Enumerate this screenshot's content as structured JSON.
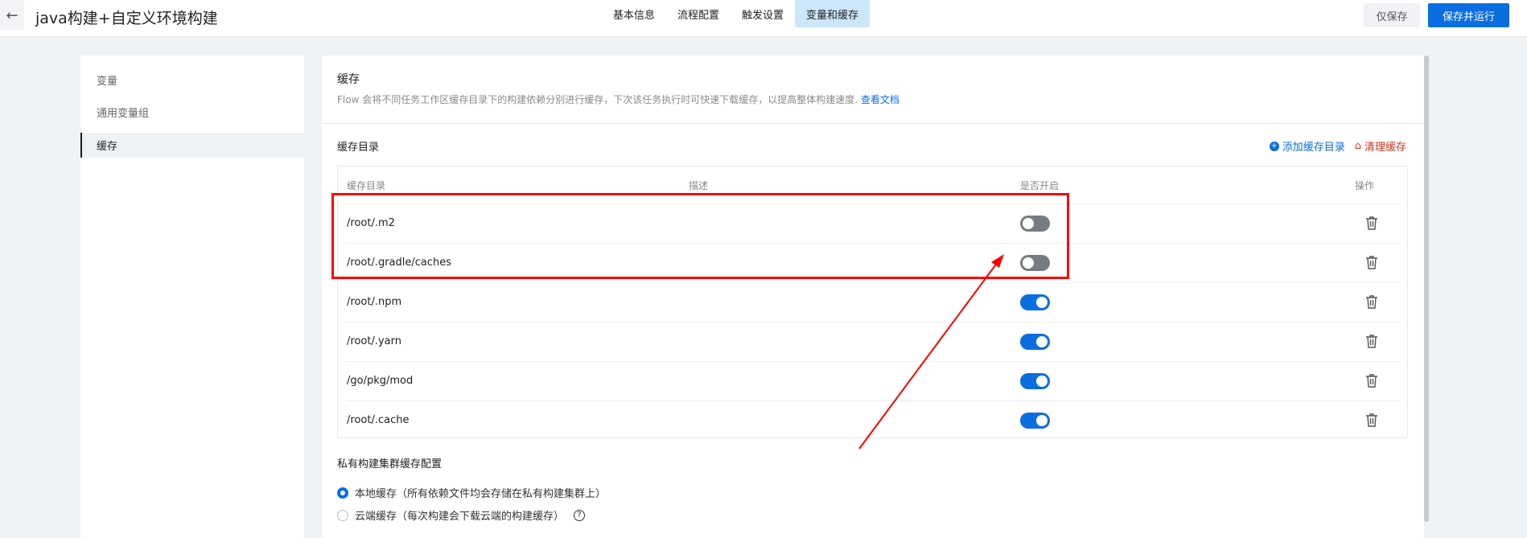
{
  "header": {
    "title": "java构建+自定义环境构建",
    "tabs": [
      {
        "label": "基本信息"
      },
      {
        "label": "流程配置"
      },
      {
        "label": "触发设置"
      },
      {
        "label": "变量和缓存"
      }
    ],
    "save_label": "仅保存",
    "save_run_label": "保存并运行"
  },
  "sidebar": {
    "items": [
      {
        "label": "变量"
      },
      {
        "label": "通用变量组"
      },
      {
        "label": "缓存"
      }
    ]
  },
  "main": {
    "title": "缓存",
    "description": "Flow 会将不同任务工作区缓存目录下的构建依赖分别进行缓存，下次该任务执行时可快速下载缓存，以提高整体构建速度.",
    "doc_link": "查看文档",
    "cache_dir_title": "缓存目录",
    "add_label": "添加缓存目录",
    "clear_label": "清理缓存",
    "columns": [
      "缓存目录",
      "描述",
      "是否开启",
      "操作"
    ],
    "rows": [
      {
        "path": "/root/.m2",
        "enabled": false
      },
      {
        "path": "/root/.gradle/caches",
        "enabled": false
      },
      {
        "path": "/root/.npm",
        "enabled": true
      },
      {
        "path": "/root/.yarn",
        "enabled": true
      },
      {
        "path": "/go/pkg/mod",
        "enabled": true
      },
      {
        "path": "/root/.cache",
        "enabled": true
      }
    ],
    "private_title": "私有构建集群缓存配置",
    "radio_options": [
      {
        "label": "本地缓存（所有依赖文件均会存储在私有构建集群上）",
        "selected": true
      },
      {
        "label": "云端缓存（每次构建会下载云端的构建缓存）",
        "selected": false
      }
    ]
  },
  "colors": {
    "accent": "#0a6ee0",
    "danger": "#d8331f",
    "annotation": "#ff0000"
  }
}
